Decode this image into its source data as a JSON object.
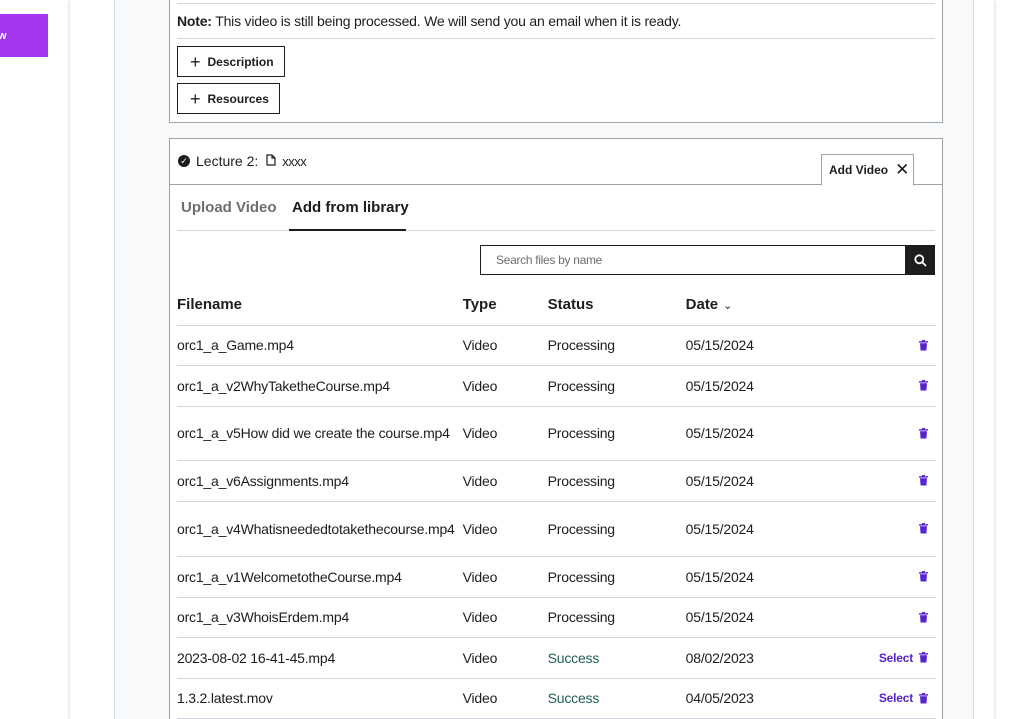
{
  "left_button": {
    "label": "w"
  },
  "lecture1": {
    "note_label": "Note:",
    "note_text": " This video is still being processed. We will send you an email when it is ready.",
    "description_button": "Description",
    "resources_button": "Resources"
  },
  "lecture2": {
    "title": "Lecture 2:",
    "name": "xxxx",
    "add_video_tab": "Add Video",
    "tabs": [
      {
        "label": "Upload Video"
      },
      {
        "label": "Add from library"
      }
    ],
    "search": {
      "placeholder": "Search files by name"
    },
    "table": {
      "headers": {
        "filename": "Filename",
        "type": "Type",
        "status": "Status",
        "date": "Date"
      },
      "rows": [
        {
          "filename": "orc1_a_Game.mp4",
          "type": "Video",
          "status": "Processing",
          "date": "05/15/2024",
          "action": ""
        },
        {
          "filename": "orc1_a_v2WhyTaketheCourse.mp4",
          "type": "Video",
          "status": "Processing",
          "date": "05/15/2024",
          "action": ""
        },
        {
          "filename": "orc1_a_v5How did we create the course.mp4",
          "type": "Video",
          "status": "Processing",
          "date": "05/15/2024",
          "action": ""
        },
        {
          "filename": "orc1_a_v6Assignments.mp4",
          "type": "Video",
          "status": "Processing",
          "date": "05/15/2024",
          "action": ""
        },
        {
          "filename": "orc1_a_v4Whatisneededtotakethecourse.mp4",
          "type": "Video",
          "status": "Processing",
          "date": "05/15/2024",
          "action": ""
        },
        {
          "filename": "orc1_a_v1WelcometotheCourse.mp4",
          "type": "Video",
          "status": "Processing",
          "date": "05/15/2024",
          "action": ""
        },
        {
          "filename": "orc1_a_v3WhoisErdem.mp4",
          "type": "Video",
          "status": "Processing",
          "date": "05/15/2024",
          "action": ""
        },
        {
          "filename": "2023-08-02 16-41-45.mp4",
          "type": "Video",
          "status": "Success",
          "date": "08/02/2023",
          "action": "Select"
        },
        {
          "filename": "1.3.2.latest.mov",
          "type": "Video",
          "status": "Success",
          "date": "04/05/2023",
          "action": "Select"
        }
      ]
    }
  },
  "colors": {
    "accent": "#a435f0",
    "link": "#5624d0",
    "success": "#1e6055",
    "text": "#1c1d1f"
  }
}
